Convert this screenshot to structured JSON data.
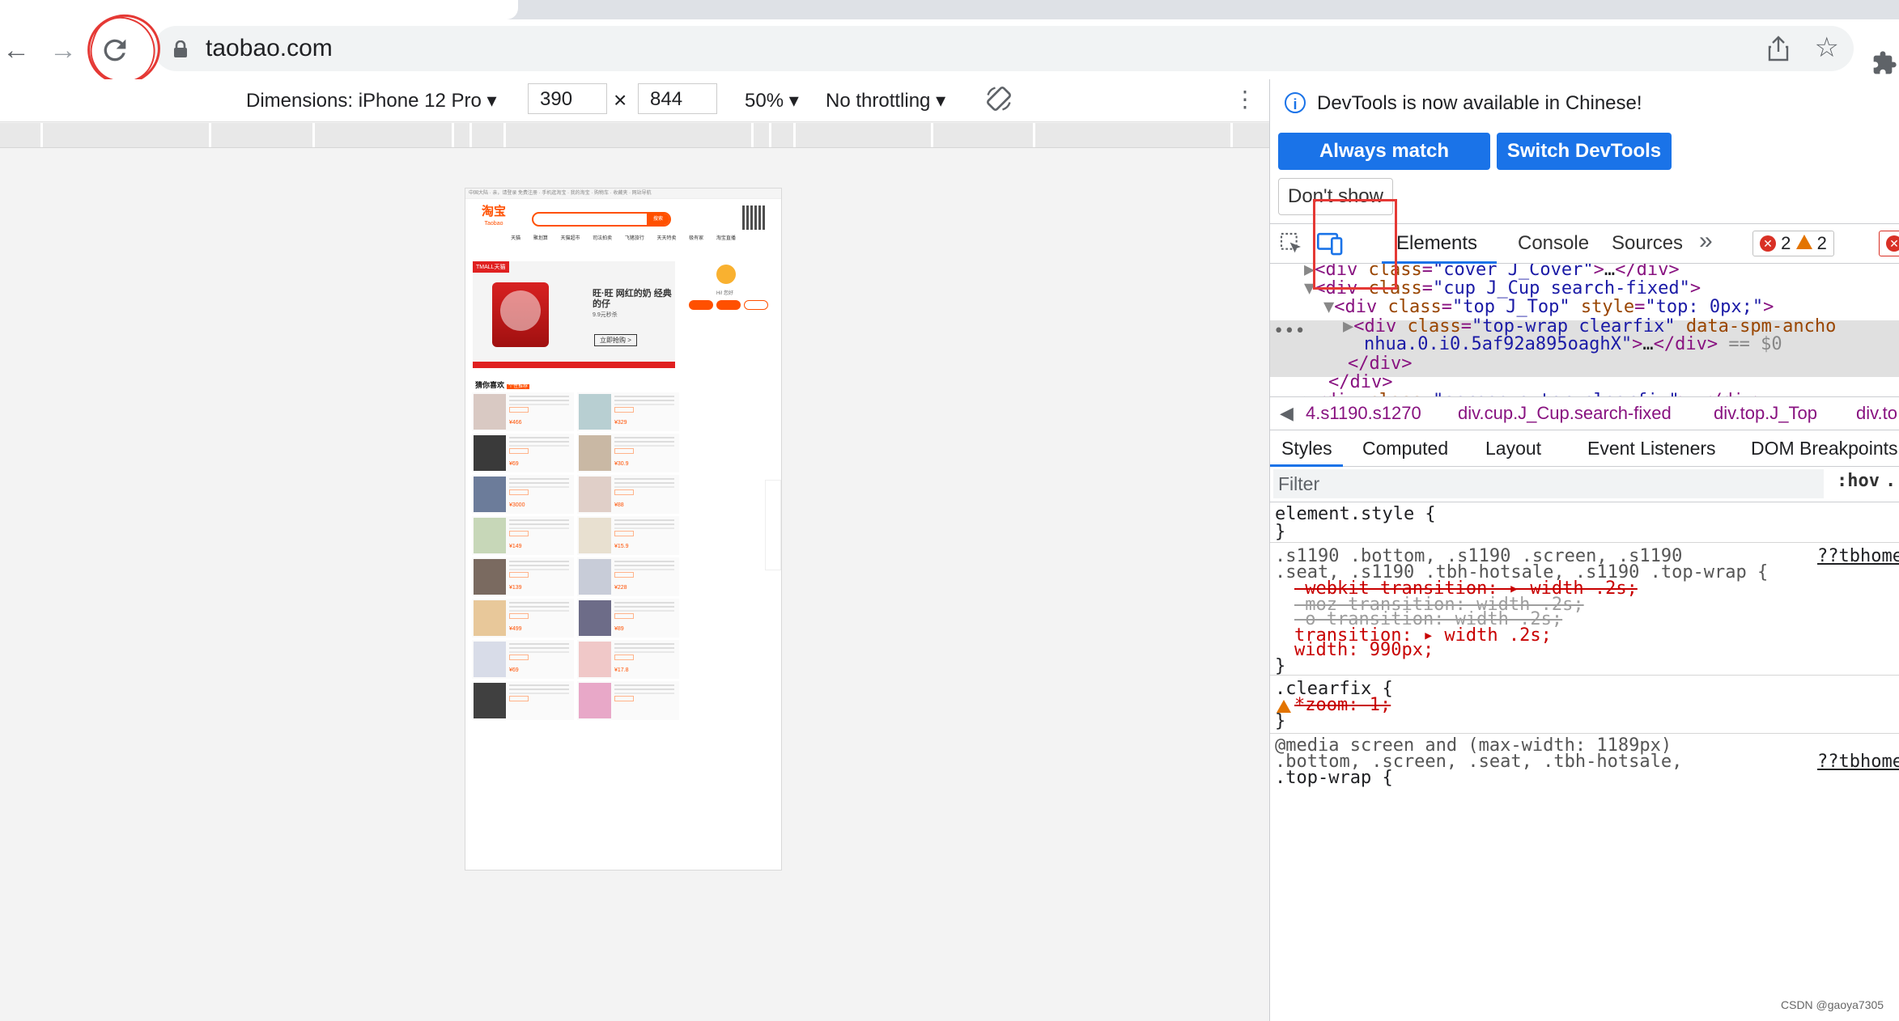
{
  "browser": {
    "url": "taobao.com",
    "back_icon": "arrow-left-icon",
    "forward_icon": "arrow-right-icon",
    "reload_icon": "reload-icon",
    "lock_icon": "lock-icon",
    "share_icon": "share-icon",
    "bookmark_icon": "star-icon",
    "extensions_icon": "puzzle-icon"
  },
  "device_toolbar": {
    "dimensions_label": "Dimensions: iPhone 12 Pro",
    "width": "390",
    "times": "×",
    "height": "844",
    "zoom": "50%",
    "throttling": "No throttling"
  },
  "phone": {
    "logo": "淘宝",
    "logo_sub": "Taobao",
    "search_button": "搜索",
    "nav": "天猫 聚划算 天猫超市 司法拍卖 飞猪旅行 天天特卖 极有家 淘宝直播",
    "banner_tag": "TMALL天猫",
    "banner_title": "旺·旺 网红的奶 经典的仔",
    "banner_price": "9.9元秒杀",
    "banner_button": "立即抢购 >",
    "greeting": "Hi! 您好",
    "guess_like": "猜你喜欢",
    "guess_like_tag": "个性推荐",
    "prices": [
      "¥466",
      "¥329",
      "¥69",
      "¥30.9",
      "¥3000",
      "¥88",
      "¥149",
      "¥15.9",
      "¥139",
      "¥228",
      "¥499",
      "¥89",
      "¥69",
      "¥17.8",
      "",
      ""
    ]
  },
  "devtools": {
    "info_message": "DevTools is now available in Chinese!",
    "btn_match": "Always match Chrome's language",
    "btn_switch": "Switch DevTools to Chinese",
    "btn_dont_show": "Don't show again",
    "tabs": [
      "Elements",
      "Console",
      "Sources"
    ],
    "more_tabs": "»",
    "errors": "2",
    "warnings": "2",
    "dom_lines": [
      "▶<div class=\"cover J_Cover\">…</div>",
      "▼<div class=\"cup J_Cup search-fixed\">",
      "▼<div class=\"top J_Top\" style=\"top: 0px;\">",
      "▶<div class=\"top-wrap clearfix\" data-spm-ancho",
      "nhua.0.i0.5af92a895oaghX\">…</div> == $0",
      "</div>",
      "</div>",
      "▶<div class=\"screen-outer clearfix\">…</div>"
    ],
    "breadcrumbs": [
      "4.s1190.s1270",
      "div.cup.J_Cup.search-fixed",
      "div.top.J_Top",
      "div.to"
    ],
    "style_tabs": [
      "Styles",
      "Computed",
      "Layout",
      "Event Listeners",
      "DOM Breakpoints"
    ],
    "filter_placeholder": "Filter",
    "hov": ":hov",
    "dot": ".",
    "rule1": "element.style {",
    "rule1_close": "}",
    "rule2_sel1": ".s1190 .bottom, .s1190 .screen, .s1190",
    "rule2_sel2": ".seat, .s1190 .tbh-hotsale, .s1190 .top-wrap {",
    "rule2_src": "??tbhome",
    "rule2_props": [
      "-webkit-transition: ▸ width .2s;",
      "-moz-transition: width .2s;",
      "-o-transition: width .2s;",
      "transition: ▸ width .2s;",
      "width: 990px;"
    ],
    "rule3_sel": ".clearfix {",
    "rule3_prop": "*zoom: 1;",
    "media": "@media screen and (max-width: 1189px)",
    "rule4_sel1": ".bottom, .screen, .seat, .tbh-hotsale,",
    "rule4_sel2": ".top-wrap {",
    "rule4_src": "??tbhome"
  },
  "watermark": "CSDN @gaoya7305",
  "colors": {
    "accent": "#1a73e8",
    "annotation": "#e53935",
    "taobao_orange": "#ff5000"
  }
}
